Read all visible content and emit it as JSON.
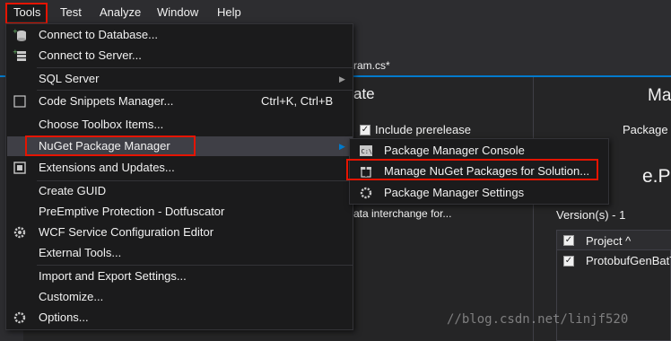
{
  "menubar": {
    "items": [
      {
        "label": "Tools"
      },
      {
        "label": "Test"
      },
      {
        "label": "Analyze"
      },
      {
        "label": "Window"
      },
      {
        "label": "Help"
      }
    ]
  },
  "background": {
    "tab_title": "ram.cs*",
    "heading_left": "ate",
    "heading_right": "Ma",
    "include_prerelease": "Include prerelease",
    "package_label": "Package",
    "package_name_partial": "e.Pr",
    "description_partial": "ata interchange for...",
    "versions_label": "Version(s) - 1",
    "project_header": "Project ^",
    "project_row": "ProtobufGenBatT"
  },
  "tools_menu": {
    "items": [
      {
        "label": "Connect to Database...",
        "icon": "database-icon"
      },
      {
        "label": "Connect to Server...",
        "icon": "server-icon"
      },
      {
        "label": "SQL Server",
        "submenu": true
      },
      {
        "label": "Code Snippets Manager...",
        "shortcut": "Ctrl+K, Ctrl+B",
        "icon": "checkbox-icon"
      },
      {
        "label": "Choose Toolbox Items..."
      },
      {
        "label": "NuGet Package Manager",
        "submenu": true,
        "highlighted": true
      },
      {
        "label": "Extensions and Updates...",
        "icon": "extensions-icon"
      },
      {
        "label": "Create GUID"
      },
      {
        "label": "PreEmptive Protection - Dotfuscator"
      },
      {
        "label": "WCF Service Configuration Editor",
        "icon": "gear-icon"
      },
      {
        "label": "External Tools..."
      },
      {
        "label": "Import and Export Settings..."
      },
      {
        "label": "Customize..."
      },
      {
        "label": "Options...",
        "icon": "gear-icon"
      }
    ]
  },
  "nuget_submenu": {
    "items": [
      {
        "label": "Package Manager Console",
        "icon": "console-icon"
      },
      {
        "label": "Manage NuGet Packages for Solution...",
        "icon": "package-icon"
      },
      {
        "label": "Package Manager Settings",
        "icon": "gear-icon"
      }
    ]
  },
  "watermark": "//blog.csdn.net/linjf520",
  "colors": {
    "menu_bg": "#1b1b1c",
    "highlight": "#3f3f46",
    "accent": "#007acc",
    "annotation": "#e51400"
  }
}
